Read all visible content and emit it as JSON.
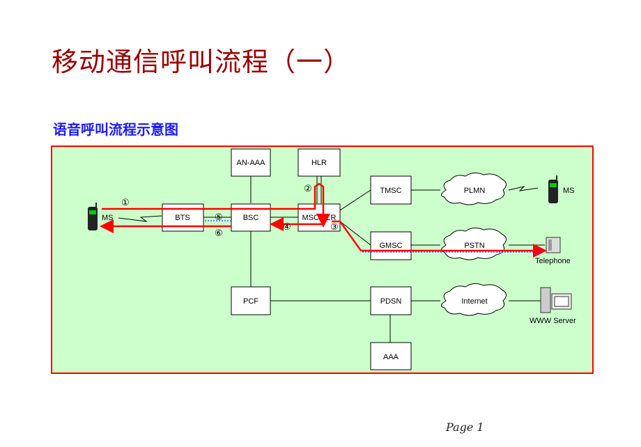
{
  "title": "移动通信呼叫流程（一）",
  "subtitle": "语音呼叫流程示意图",
  "page_label": "Page 1",
  "colors": {
    "title": "#990000",
    "subtitle": "#1a1aff",
    "frame": "#ff0000",
    "background": "#ccffcc",
    "flow": "#ff0000",
    "flow_dotted": "#3333ff"
  },
  "diagram": {
    "nodes": {
      "an_aaa": "AN-AAA",
      "hlr": "HLR",
      "bts": "BTS",
      "bsc": "BSC",
      "msc_vlr": "MSC/VLR",
      "tmsc": "TMSC",
      "gmsc": "GMSC",
      "pcf": "PCF",
      "pdsn": "PDSN",
      "aaa": "AAA"
    },
    "clouds": {
      "plmn": "PLMN",
      "pstn": "PSTN",
      "internet": "Internet"
    },
    "devices": {
      "ms_left": "MS",
      "ms_right": "MS",
      "telephone": "Telephone",
      "www_server": "WWW Server"
    },
    "steps": [
      "①",
      "②",
      "③",
      "④",
      "⑤",
      "⑥"
    ]
  }
}
